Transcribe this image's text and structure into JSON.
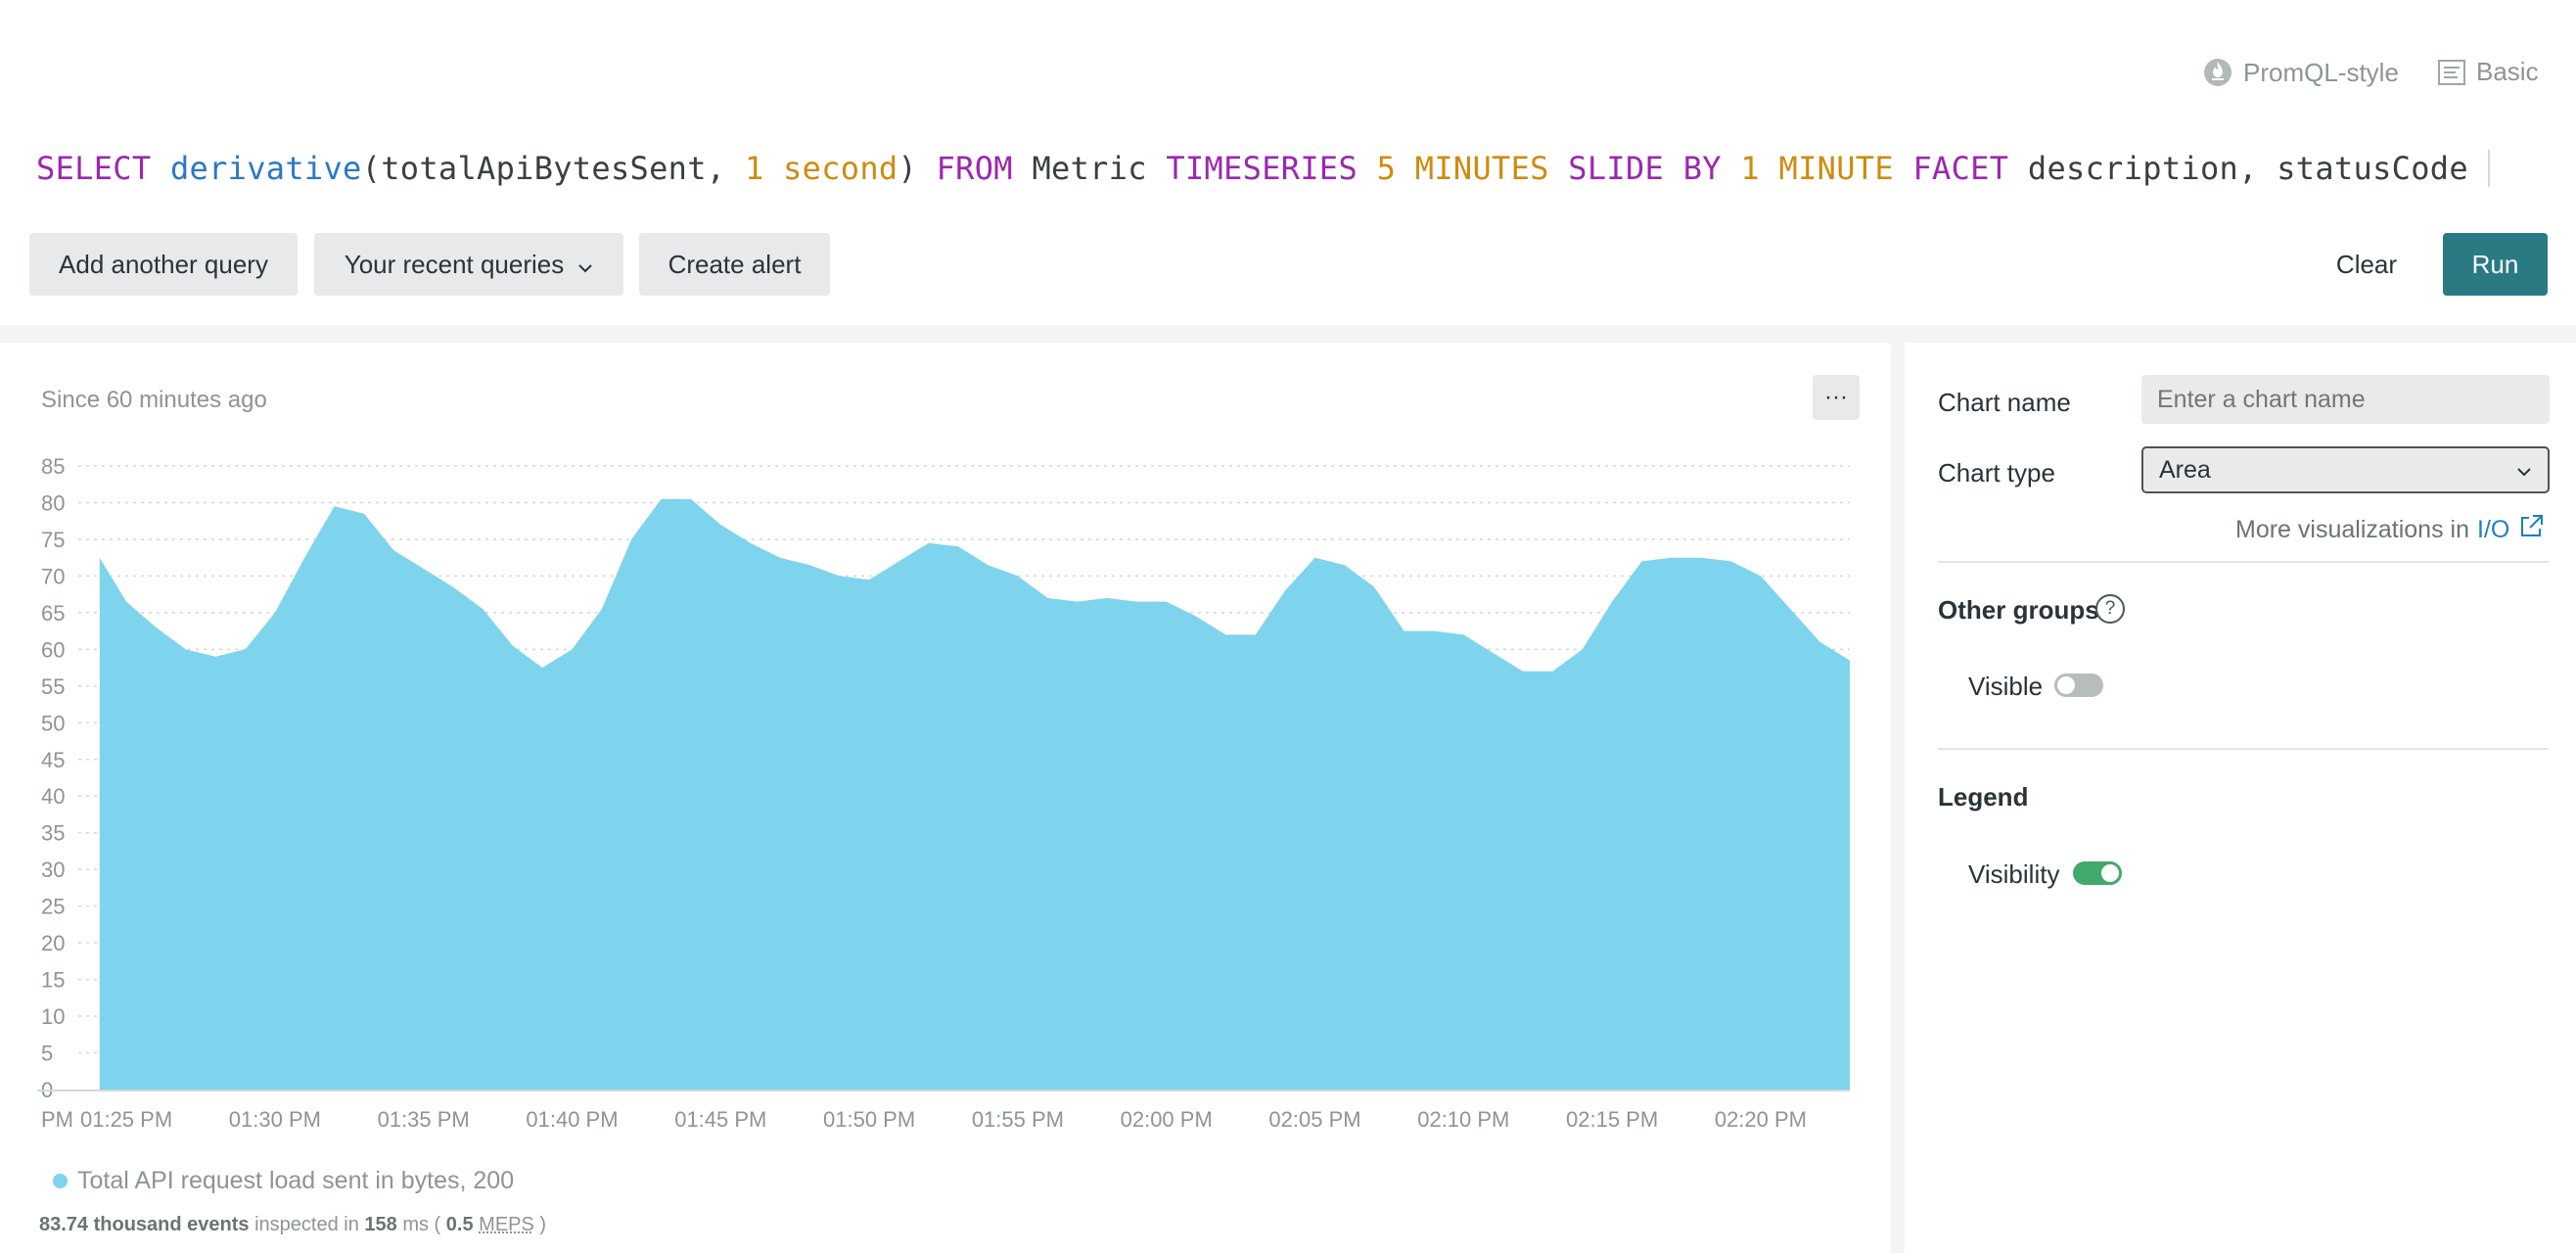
{
  "header": {
    "mode_promql": "PromQL-style",
    "mode_basic": "Basic"
  },
  "query": {
    "tokens": [
      {
        "text": "SELECT ",
        "kind": "kw"
      },
      {
        "text": "derivative",
        "kind": "fn"
      },
      {
        "text": "(totalApiBytesSent, ",
        "kind": "id"
      },
      {
        "text": "1 second",
        "kind": "num"
      },
      {
        "text": ") ",
        "kind": "id"
      },
      {
        "text": "FROM ",
        "kind": "kw"
      },
      {
        "text": "Metric ",
        "kind": "id"
      },
      {
        "text": "TIMESERIES ",
        "kind": "kw"
      },
      {
        "text": "5 MINUTES ",
        "kind": "num"
      },
      {
        "text": "SLIDE BY ",
        "kind": "kw"
      },
      {
        "text": "1 MINUTE ",
        "kind": "num"
      },
      {
        "text": "FACET ",
        "kind": "kw"
      },
      {
        "text": "description, statusCode",
        "kind": "id"
      }
    ]
  },
  "toolbar": {
    "add_query": "Add another query",
    "recent_queries": "Your recent queries",
    "create_alert": "Create alert",
    "clear": "Clear",
    "run": "Run"
  },
  "chart_card": {
    "since": "Since 60 minutes ago",
    "more": "···",
    "stats": {
      "events": "83.74 thousand events",
      "inspected_in": "inspected in",
      "ms": "158",
      "ms_unit": "ms (",
      "meps_value": "0.5",
      "meps": "MEPS",
      "close": ")"
    }
  },
  "chart_data": {
    "type": "area",
    "title": "",
    "xlabel": "",
    "ylabel": "",
    "ylim": [
      0,
      85
    ],
    "yticks": [
      0,
      5,
      10,
      15,
      20,
      25,
      30,
      35,
      40,
      45,
      50,
      55,
      60,
      65,
      70,
      75,
      80,
      85
    ],
    "xtick_labels": [
      "PM",
      "01:25 PM",
      "01:30 PM",
      "01:35 PM",
      "01:40 PM",
      "01:45 PM",
      "01:50 PM",
      "01:55 PM",
      "02:00 PM",
      "02:05 PM",
      "02:10 PM",
      "02:15 PM",
      "02:20 PM"
    ],
    "xtick_minutes": [
      82,
      85,
      90,
      95,
      100,
      105,
      110,
      115,
      120,
      125,
      130,
      135,
      140
    ],
    "xlim_minutes": [
      82,
      143
    ],
    "grid": "horizontal dotted",
    "color": "#7ed4ec",
    "series": [
      {
        "name": "Total API request load sent in bytes, 200",
        "x_minutes": [
          84.1,
          85,
          86,
          87,
          88,
          89,
          90,
          91,
          92,
          93,
          94,
          95,
          96,
          97,
          98,
          99,
          100,
          101,
          102,
          103,
          104,
          105,
          106,
          107,
          108,
          109,
          110,
          111,
          112,
          113,
          114,
          115,
          116,
          117,
          118,
          119,
          120,
          121,
          122,
          123,
          124,
          125,
          126,
          127,
          128,
          129,
          130,
          131,
          132,
          133,
          134,
          135,
          136,
          137,
          138,
          139,
          140,
          141,
          142,
          143
        ],
        "values": [
          72.5,
          66.5,
          63,
          60,
          59,
          60,
          65,
          72.5,
          79.5,
          78.5,
          73.5,
          71,
          68.5,
          65.5,
          60.5,
          57.5,
          60,
          65.5,
          75,
          80.5,
          80.5,
          77,
          74.5,
          72.5,
          71.5,
          70,
          69.5,
          72,
          74.5,
          74,
          71.5,
          70,
          67,
          66.5,
          67,
          66.5,
          66.5,
          64.5,
          62,
          62,
          68,
          72.5,
          71.5,
          68.5,
          62.5,
          62.5,
          62,
          59.5,
          57,
          57,
          60,
          66.5,
          72,
          72.5,
          72.5,
          72,
          70,
          65.5,
          61,
          58.5
        ]
      }
    ]
  },
  "panel": {
    "chart_name_label": "Chart name",
    "chart_name_placeholder": "Enter a chart name",
    "chart_type_label": "Chart type",
    "chart_type_value": "Area",
    "more_vis_prefix": "More visualizations in",
    "more_vis_link": "I/O",
    "other_groups": "Other groups",
    "help": "?",
    "visible": "Visible",
    "visible_on": false,
    "legend": "Legend",
    "visibility": "Visibility",
    "visibility_on": true
  }
}
